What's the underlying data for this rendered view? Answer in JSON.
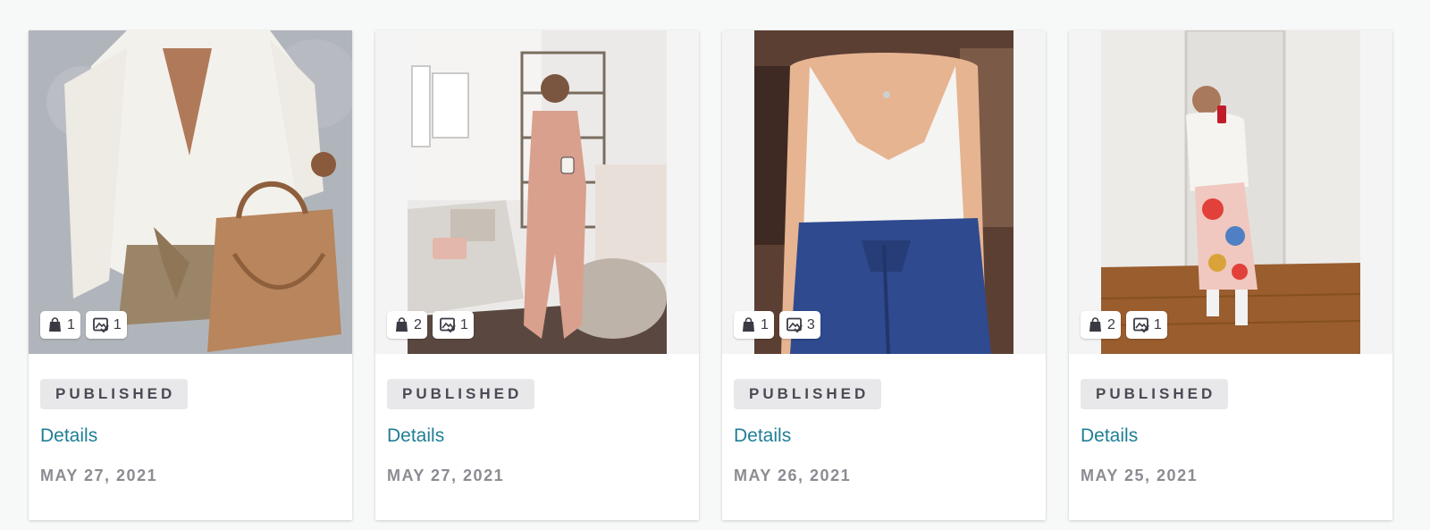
{
  "posts": [
    {
      "status": "PUBLISHED",
      "details_label": "Details",
      "date": "MAY 27, 2021",
      "products_count": "1",
      "photos_count": "1",
      "image_desc": "woman-white-knit-sweater-tan-bag"
    },
    {
      "status": "PUBLISHED",
      "details_label": "Details",
      "date": "MAY 27, 2021",
      "products_count": "2",
      "photos_count": "1",
      "image_desc": "woman-pink-jumpsuit-living-room"
    },
    {
      "status": "PUBLISHED",
      "details_label": "Details",
      "date": "MAY 26, 2021",
      "products_count": "1",
      "photos_count": "3",
      "image_desc": "woman-white-cami-denim-skirt"
    },
    {
      "status": "PUBLISHED",
      "details_label": "Details",
      "date": "MAY 25, 2021",
      "products_count": "2",
      "photos_count": "1",
      "image_desc": "woman-floral-skirt-mirror-selfie"
    }
  ],
  "icons": {
    "products": "shopping-bag-icon",
    "photos": "verified-image-icon"
  },
  "colors": {
    "link": "#1f7e95",
    "badge_bg": "#e8e8ea",
    "badge_text": "#4a4a55",
    "date_text": "#8b8b92"
  }
}
